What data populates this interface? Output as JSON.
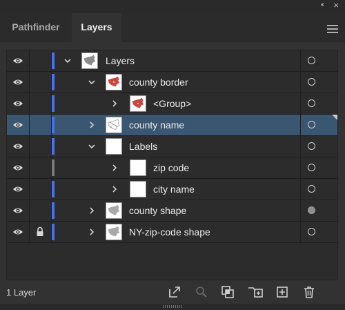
{
  "tabs": [
    {
      "label": "Pathfinder",
      "active": false
    },
    {
      "label": "Layers",
      "active": true
    }
  ],
  "layers": [
    {
      "label": "Layers",
      "depth": 0,
      "expanded": true,
      "visible": true,
      "locked": false,
      "color": "#4a72e8",
      "thumb": "map",
      "target_filled": false,
      "selected": false
    },
    {
      "label": "county border",
      "depth": 1,
      "expanded": true,
      "visible": true,
      "locked": false,
      "color": "#4a72e8",
      "thumb": "red-map",
      "target_filled": false,
      "selected": false
    },
    {
      "label": "<Group>",
      "depth": 2,
      "expanded": false,
      "visible": true,
      "locked": false,
      "color": "#4a72e8",
      "thumb": "red-map",
      "target_filled": false,
      "selected": false
    },
    {
      "label": "county name",
      "depth": 1,
      "expanded": false,
      "visible": true,
      "locked": false,
      "color": "#4a72e8",
      "thumb": "text-map",
      "target_filled": false,
      "selected": true
    },
    {
      "label": "Labels",
      "depth": 1,
      "expanded": true,
      "visible": true,
      "locked": false,
      "color": "#4a72e8",
      "thumb": "blank",
      "target_filled": false,
      "selected": false
    },
    {
      "label": "zip code",
      "depth": 2,
      "expanded": false,
      "visible": true,
      "locked": false,
      "color": "#7a7a7a",
      "thumb": "blank",
      "target_filled": false,
      "selected": false
    },
    {
      "label": "city name",
      "depth": 2,
      "expanded": false,
      "visible": true,
      "locked": false,
      "color": "#4a72e8",
      "thumb": "blank",
      "target_filled": false,
      "selected": false
    },
    {
      "label": "county shape",
      "depth": 1,
      "expanded": false,
      "visible": true,
      "locked": false,
      "color": "#4a72e8",
      "thumb": "grey-map",
      "target_filled": true,
      "selected": false
    },
    {
      "label": "NY-zip-code shape",
      "depth": 1,
      "expanded": false,
      "visible": true,
      "locked": true,
      "color": "#4a72e8",
      "thumb": "grey-map",
      "target_filled": false,
      "selected": false
    }
  ],
  "footer": {
    "count_label": "1 Layer",
    "icons": [
      "export-icon",
      "search-icon",
      "mask-icon",
      "sublayer-icon",
      "new-layer-icon",
      "trash-icon"
    ]
  },
  "colors": {
    "accent": "#4a72e8",
    "selected_row": "#3b5670",
    "panel_bg": "#323232"
  }
}
